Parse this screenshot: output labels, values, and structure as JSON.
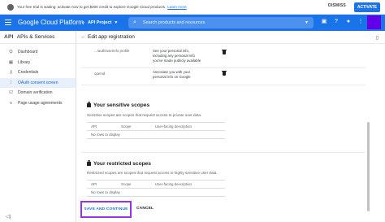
{
  "banner": {
    "message": "Your free trial is waiting: activate now to get $300 credit to explore Google Cloud products.",
    "learn_more": "Learn more",
    "dismiss": "DISMISS",
    "activate": "ACTIVATE"
  },
  "topbar": {
    "brand": "Google Cloud Platform",
    "project": "API Project",
    "search_placeholder": "Search products and resources"
  },
  "sidebar": {
    "api_badge": "API",
    "title": "APIs & Services",
    "items": [
      {
        "label": "Dashboard",
        "icon": "dashboard-icon"
      },
      {
        "label": "Library",
        "icon": "library-icon"
      },
      {
        "label": "Credentials",
        "icon": "key-icon"
      },
      {
        "label": "OAuth consent screen",
        "icon": "consent-icon",
        "active": true
      },
      {
        "label": "Domain verification",
        "icon": "checkbox-icon"
      },
      {
        "label": "Page usage agreements",
        "icon": "settings-list-icon"
      }
    ]
  },
  "main": {
    "title": "Edit app registration",
    "scopes": [
      {
        "api": "",
        "scope": "",
        "desc": "See your personal info, including any personal info you've made publicly available"
      },
      {
        "api": "",
        "scope": "openid",
        "desc": "Associate you with your personal info on Google"
      }
    ],
    "scope_first_partial": ".../auth/userinfo profile",
    "sensitive": {
      "title": "Your sensitive scopes",
      "desc": "Sensitive scopes are scopes that request access to private user data.",
      "col_api": "API",
      "col_scope": "Scope",
      "col_desc": "User-facing description",
      "empty": "No rows to display"
    },
    "restricted": {
      "title": "Your restricted scopes",
      "desc": "Restricted scopes are scopes that request access to highly sensitive user data.",
      "col_api": "API",
      "col_scope": "Scope",
      "col_desc": "User-facing description",
      "empty": "No rows to display"
    },
    "save_button": "SAVE AND CONTINUE",
    "cancel_button": "CANCEL"
  },
  "colors": {
    "accent": "#1a73e8",
    "highlight_border": "#9334e6",
    "avatar": "#6200ea"
  }
}
